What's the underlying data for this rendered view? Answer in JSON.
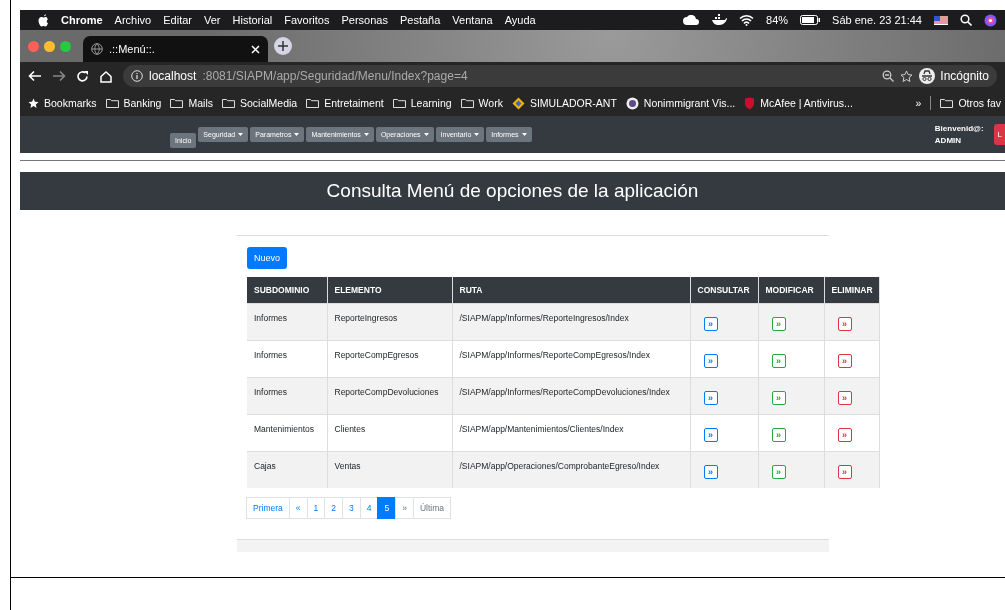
{
  "menu_bar": {
    "app": "Chrome",
    "items": [
      "Archivo",
      "Editar",
      "Ver",
      "Historial",
      "Favoritos",
      "Personas",
      "Pestaña",
      "Ventana",
      "Ayuda"
    ],
    "battery": "84%",
    "clock": "Sáb ene. 23  21:44"
  },
  "tabs": [
    {
      "title": ".::Menú::.",
      "selected": true
    }
  ],
  "address": {
    "host": "localhost",
    "path": ":8081/SIAPM/app/Seguridad/Menu/Index?page=4",
    "profile": "Incógnito"
  },
  "bookmarks": [
    {
      "label": "Bookmarks",
      "kind": "star"
    },
    {
      "label": "Banking",
      "kind": "folder"
    },
    {
      "label": "Mails",
      "kind": "folder"
    },
    {
      "label": "SocialMedia",
      "kind": "folder"
    },
    {
      "label": "Entretaiment",
      "kind": "folder"
    },
    {
      "label": "Learning",
      "kind": "folder"
    },
    {
      "label": "Work",
      "kind": "folder"
    },
    {
      "label": "SIMULADOR-ANT",
      "kind": "diamond"
    },
    {
      "label": "Nonimmigrant Vis...",
      "kind": "seal"
    },
    {
      "label": "McAfee | Antivirus...",
      "kind": "shield"
    }
  ],
  "bookmarks_overflow": "»",
  "other_bookmarks": "Otros fav",
  "navbar": {
    "home": "Inicio",
    "menus": [
      "Seguridad",
      "Parametros",
      "Mantenimientos",
      "Operaciones",
      "Inventario",
      "Informes"
    ],
    "greeting": "Bienvenid@:",
    "user": "ADMIN",
    "logout": "L"
  },
  "page_title": "Consulta Menú de opciones de la aplicación",
  "new_button": "Nuevo",
  "table": {
    "columns": [
      "SUBDOMINIO",
      "ELEMENTO",
      "RUTA",
      "CONSULTAR",
      "MODIFICAR",
      "ELIMINAR"
    ],
    "rows": [
      {
        "subdominio": "Informes",
        "elemento": "ReporteIngresos",
        "ruta": "/SIAPM/app/Informes/ReporteIngresos/Index",
        "actions": [
          {
            "kind": "consult",
            "label": "»"
          },
          {
            "kind": "modify",
            "label": "»"
          },
          {
            "kind": "delete",
            "label": "»"
          }
        ]
      },
      {
        "subdominio": "Informes",
        "elemento": "ReporteCompEgresos",
        "ruta": "/SIAPM/app/Informes/ReporteCompEgresos/Index",
        "actions": [
          {
            "kind": "consult",
            "label": "»"
          },
          {
            "kind": "modify",
            "label": "»"
          },
          {
            "kind": "delete",
            "label": "»"
          }
        ]
      },
      {
        "subdominio": "Informes",
        "elemento": "ReporteCompDevoluciones",
        "ruta": "/SIAPM/app/Informes/ReporteCompDevoluciones/Index",
        "actions": [
          {
            "kind": "consult",
            "label": "»"
          },
          {
            "kind": "modify",
            "label": "»"
          },
          {
            "kind": "delete",
            "label": "»"
          }
        ]
      },
      {
        "subdominio": "Mantenimientos",
        "elemento": "Clientes",
        "ruta": "/SIAPM/app/Mantenimientos/Clientes/Index",
        "actions": [
          {
            "kind": "consult",
            "label": "»"
          },
          {
            "kind": "modify",
            "label": "»"
          },
          {
            "kind": "delete",
            "label": "»"
          }
        ]
      },
      {
        "subdominio": "Cajas",
        "elemento": "Ventas",
        "ruta": "/SIAPM/app/Operaciones/ComprobanteEgreso/Index",
        "actions": [
          {
            "kind": "consult",
            "label": "»"
          },
          {
            "kind": "modify",
            "label": "»"
          },
          {
            "kind": "delete",
            "label": "»"
          }
        ]
      }
    ]
  },
  "pagination": [
    {
      "label": "Primera",
      "selected": false,
      "disabled": false
    },
    {
      "label": "«",
      "selected": false,
      "disabled": false
    },
    {
      "label": "1",
      "selected": false,
      "disabled": false
    },
    {
      "label": "2",
      "selected": false,
      "disabled": false
    },
    {
      "label": "3",
      "selected": false,
      "disabled": false
    },
    {
      "label": "4",
      "selected": false,
      "disabled": false
    },
    {
      "label": "5",
      "selected": true,
      "disabled": false
    },
    {
      "label": "»",
      "selected": false,
      "disabled": true
    },
    {
      "label": "Última",
      "selected": false,
      "disabled": true
    }
  ]
}
